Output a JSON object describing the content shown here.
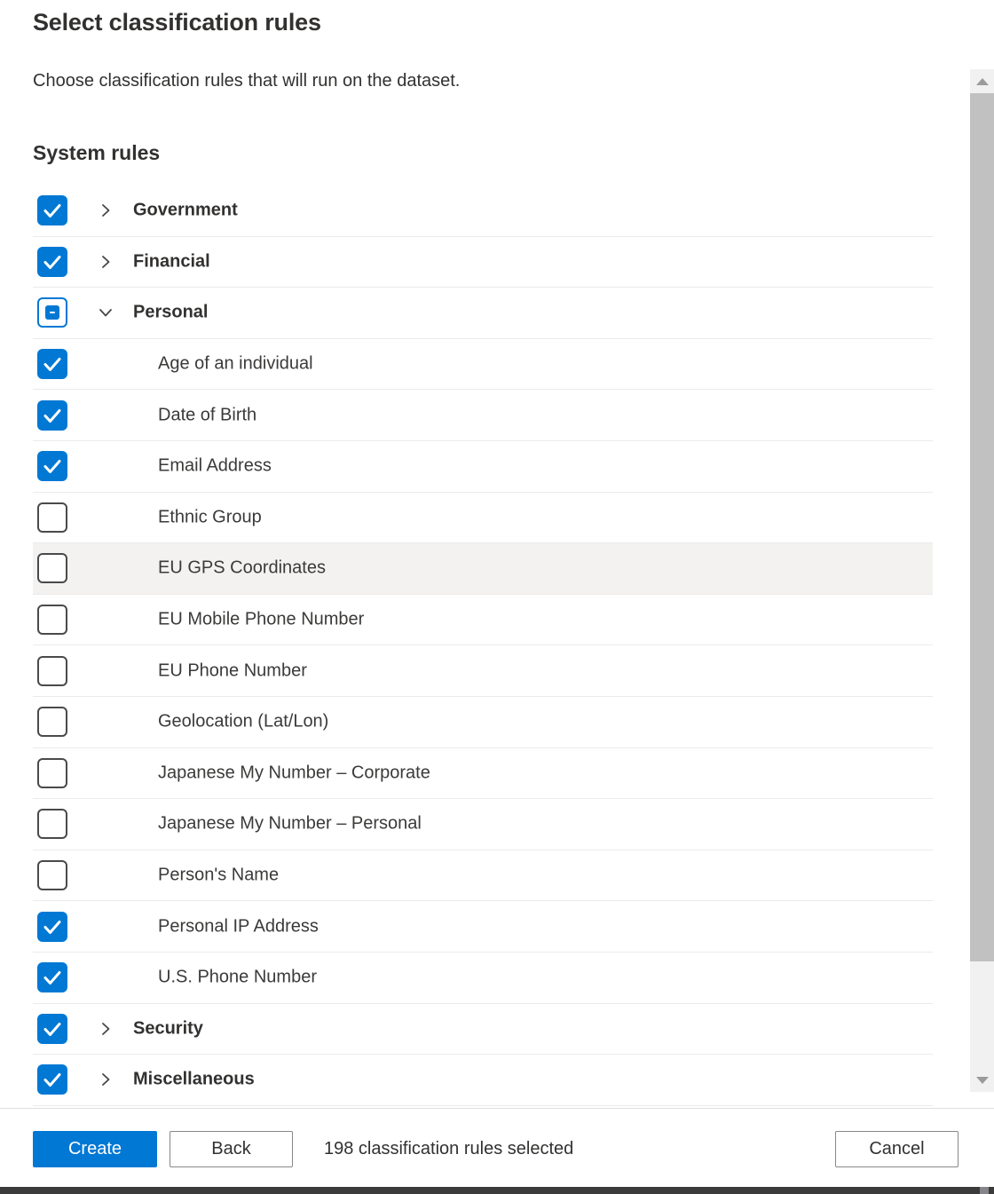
{
  "page": {
    "title": "Select classification rules",
    "subtitle": "Choose classification rules that will run on the dataset.",
    "section_heading": "System rules"
  },
  "rules_tree": {
    "rows": [
      {
        "label": "Government",
        "level": "parent",
        "checkbox": "checked",
        "chevron": "right",
        "highlighted": false
      },
      {
        "label": "Financial",
        "level": "parent",
        "checkbox": "checked",
        "chevron": "right",
        "highlighted": false
      },
      {
        "label": "Personal",
        "level": "parent",
        "checkbox": "indeterminate",
        "chevron": "down",
        "highlighted": false
      },
      {
        "label": "Age of an individual",
        "level": "child",
        "checkbox": "checked",
        "chevron": null,
        "highlighted": false
      },
      {
        "label": "Date of Birth",
        "level": "child",
        "checkbox": "checked",
        "chevron": null,
        "highlighted": false
      },
      {
        "label": "Email Address",
        "level": "child",
        "checkbox": "checked",
        "chevron": null,
        "highlighted": false
      },
      {
        "label": "Ethnic Group",
        "level": "child",
        "checkbox": "unchecked",
        "chevron": null,
        "highlighted": false
      },
      {
        "label": "EU GPS Coordinates",
        "level": "child",
        "checkbox": "unchecked",
        "chevron": null,
        "highlighted": true
      },
      {
        "label": "EU Mobile Phone Number",
        "level": "child",
        "checkbox": "unchecked",
        "chevron": null,
        "highlighted": false
      },
      {
        "label": "EU Phone Number",
        "level": "child",
        "checkbox": "unchecked",
        "chevron": null,
        "highlighted": false
      },
      {
        "label": "Geolocation (Lat/Lon)",
        "level": "child",
        "checkbox": "unchecked",
        "chevron": null,
        "highlighted": false
      },
      {
        "label": "Japanese My Number – Corporate",
        "level": "child",
        "checkbox": "unchecked",
        "chevron": null,
        "highlighted": false
      },
      {
        "label": "Japanese My Number – Personal",
        "level": "child",
        "checkbox": "unchecked",
        "chevron": null,
        "highlighted": false
      },
      {
        "label": "Person's Name",
        "level": "child",
        "checkbox": "unchecked",
        "chevron": null,
        "highlighted": false
      },
      {
        "label": "Personal IP Address",
        "level": "child",
        "checkbox": "checked",
        "chevron": null,
        "highlighted": false
      },
      {
        "label": "U.S. Phone Number",
        "level": "child",
        "checkbox": "checked",
        "chevron": null,
        "highlighted": false
      },
      {
        "label": "Security",
        "level": "parent",
        "checkbox": "checked",
        "chevron": "right",
        "highlighted": false
      },
      {
        "label": "Miscellaneous",
        "level": "parent",
        "checkbox": "checked",
        "chevron": "right",
        "highlighted": false
      }
    ]
  },
  "footer": {
    "create_label": "Create",
    "back_label": "Back",
    "status_text": "198 classification rules selected",
    "cancel_label": "Cancel"
  },
  "colors": {
    "accent": "#0078d4",
    "text": "#323130",
    "row_hover_background": "#f3f2f1",
    "row_separator": "#edebe9",
    "button_border": "#8a8886",
    "scrollbar_track": "#f1f1f1",
    "scrollbar_thumb": "#c1c1c1",
    "bottom_bar": "#3b3b3c"
  }
}
